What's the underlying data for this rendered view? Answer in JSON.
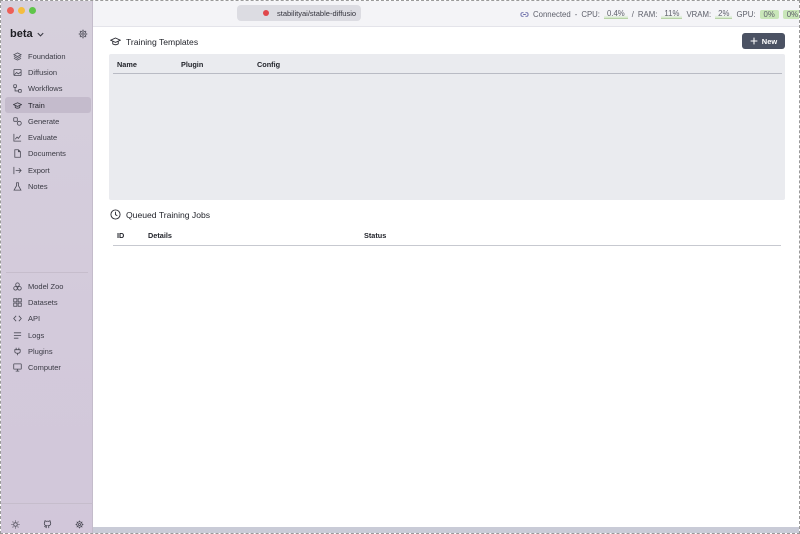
{
  "window": {
    "traffic_lights": [
      "close",
      "minimize",
      "zoom"
    ]
  },
  "sidebar": {
    "brand": "beta",
    "items_top": [
      {
        "label": "Foundation",
        "icon": "layers-icon"
      },
      {
        "label": "Diffusion",
        "icon": "image-icon"
      },
      {
        "label": "Workflows",
        "icon": "workflow-icon"
      },
      {
        "label": "Train",
        "icon": "graduation-cap-icon",
        "active": true
      },
      {
        "label": "Generate",
        "icon": "generate-icon"
      },
      {
        "label": "Evaluate",
        "icon": "chart-icon"
      },
      {
        "label": "Documents",
        "icon": "document-icon"
      },
      {
        "label": "Export",
        "icon": "export-icon"
      },
      {
        "label": "Notes",
        "icon": "flask-icon"
      }
    ],
    "items_bottom": [
      {
        "label": "Model Zoo",
        "icon": "model-zoo-icon"
      },
      {
        "label": "Datasets",
        "icon": "datasets-icon"
      },
      {
        "label": "API",
        "icon": "code-icon"
      },
      {
        "label": "Logs",
        "icon": "logs-icon"
      },
      {
        "label": "Plugins",
        "icon": "plug-icon"
      },
      {
        "label": "Computer",
        "icon": "monitor-icon"
      }
    ],
    "footer_icons": [
      "sun-icon",
      "github-icon",
      "settings-icon"
    ]
  },
  "topbar": {
    "repo": "stabilityai/stable-diffusio",
    "connection": "Connected",
    "cpu_label": "CPU:",
    "cpu_value": "0.4%",
    "ram_label": "RAM:",
    "ram_value": "11%",
    "vram_label": "VRAM:",
    "vram_value": "2%",
    "gpu_label": "GPU:",
    "gpu_value_1": "0%",
    "gpu_value_2": "0%",
    "colors": {
      "recording": "#e0474b",
      "meter": "#c9e6b9"
    }
  },
  "main": {
    "templates": {
      "title": "Training Templates",
      "new_button": "New",
      "columns": [
        "Name",
        "Plugin",
        "Config"
      ]
    },
    "jobs": {
      "title": "Queued Training Jobs",
      "columns": [
        "ID",
        "Details",
        "Status"
      ]
    }
  }
}
